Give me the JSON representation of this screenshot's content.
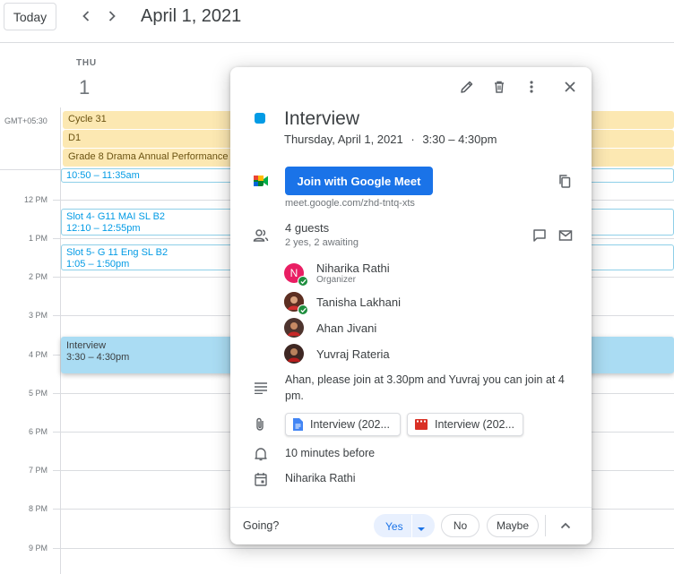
{
  "toolbar": {
    "today_label": "Today",
    "date_title": "April 1, 2021"
  },
  "day": {
    "dow": "THU",
    "num": "1"
  },
  "timezone": "GMT+05:30",
  "all_day_events": [
    {
      "title": "Cycle 31"
    },
    {
      "title": "D1"
    },
    {
      "title": "Grade 8 Drama Annual Performance"
    }
  ],
  "time_labels": [
    "12 PM",
    "1 PM",
    "2 PM",
    "3 PM",
    "4 PM",
    "5 PM",
    "6 PM",
    "7 PM",
    "8 PM",
    "9 PM"
  ],
  "timed_events": [
    {
      "title": "",
      "time": "10:50 – 11:35am"
    },
    {
      "title": "Slot 4- G11 MAI SL B2",
      "time": "12:10 – 12:55pm"
    },
    {
      "title": "Slot 5- G 11 Eng SL B2",
      "time": "1:05 – 1:50pm"
    },
    {
      "title": "Interview",
      "time": "3:30 – 4:30pm"
    }
  ],
  "popup": {
    "title": "Interview",
    "date_text": "Thursday, April 1, 2021",
    "separator": "·",
    "time_text": "3:30 – 4:30pm",
    "meet_button": "Join with Google Meet",
    "meet_link": "meet.google.com/zhd-tntq-xts",
    "guests_count": "4 guests",
    "guests_summary": "2 yes, 2 awaiting",
    "guests": [
      {
        "name": "Niharika Rathi",
        "role": "Organizer",
        "initial": "N",
        "color": "#e91e63",
        "accepted": true
      },
      {
        "name": "Tanisha Lakhani",
        "role": "",
        "initial": "",
        "color": "#7b3f2a",
        "accepted": true
      },
      {
        "name": "Ahan Jivani",
        "role": "",
        "initial": "",
        "color": "#5d4037",
        "accepted": false
      },
      {
        "name": "Yuvraj Rateria",
        "role": "",
        "initial": "",
        "color": "#4e342e",
        "accepted": false
      }
    ],
    "description": "Ahan, please join at 3.30pm and Yuvraj you can join at 4 pm.",
    "attachments": [
      {
        "name": "Interview (202...",
        "icon": "docs-icon"
      },
      {
        "name": "Interview (202...",
        "icon": "video-icon"
      }
    ],
    "reminder": "10 minutes before",
    "calendar_owner": "Niharika Rathi",
    "rsvp": {
      "label": "Going?",
      "yes": "Yes",
      "no": "No",
      "maybe": "Maybe"
    }
  },
  "colors": {
    "accent": "#1a73e8",
    "event_blue": "#039be5",
    "all_day_bg": "#fce8b2",
    "selected_event_bg": "#aadcf3"
  }
}
